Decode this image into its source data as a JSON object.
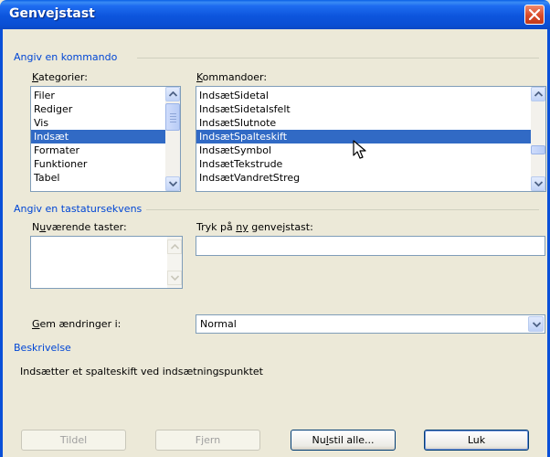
{
  "window": {
    "title": "Genvejstast"
  },
  "groups": {
    "specify_command": "Angiv en kommando",
    "specify_keys": "Angiv en tastatursekvens",
    "description": "Beskrivelse"
  },
  "categories": {
    "label_underlined": "K",
    "label_rest": "ategorier:",
    "items": [
      "Filer",
      "Rediger",
      "Vis",
      "Indsæt",
      "Formater",
      "Funktioner",
      "Tabel"
    ],
    "selected_index": 3
  },
  "commands": {
    "label_underlined": "K",
    "label_rest": "ommandoer:",
    "items": [
      "IndsætSidetal",
      "IndsætSidetalsfelt",
      "IndsætSlutnote",
      "IndsætSpalteskift",
      "IndsætSymbol",
      "IndsætTekstrude",
      "IndsætVandretStreg"
    ],
    "selected_index": 3
  },
  "current_keys": {
    "label_pre": "N",
    "label_underlined": "u",
    "label_rest": "værende taster:",
    "value": ""
  },
  "new_shortcut": {
    "label_pre": "Tryk på ",
    "label_underlined": "ny",
    "label_rest": " genvejstast:",
    "value": ""
  },
  "save_changes": {
    "label_underlined": "G",
    "label_rest": "em ændringer i:",
    "value": "Normal"
  },
  "description_text": "Indsætter et spalteskift ved indsætningspunktet",
  "buttons": {
    "assign": "Tildel",
    "remove": "Fjern",
    "reset_all_pre": "Nu",
    "reset_all_underlined": "l",
    "reset_all_rest": "stil alle...",
    "close": "Luk"
  },
  "icons": {
    "close": "close-icon",
    "scroll_up": "arrow-up-icon",
    "scroll_down": "arrow-down-icon",
    "dropdown": "chevron-down-icon",
    "cursor": "mouse-pointer-icon"
  }
}
